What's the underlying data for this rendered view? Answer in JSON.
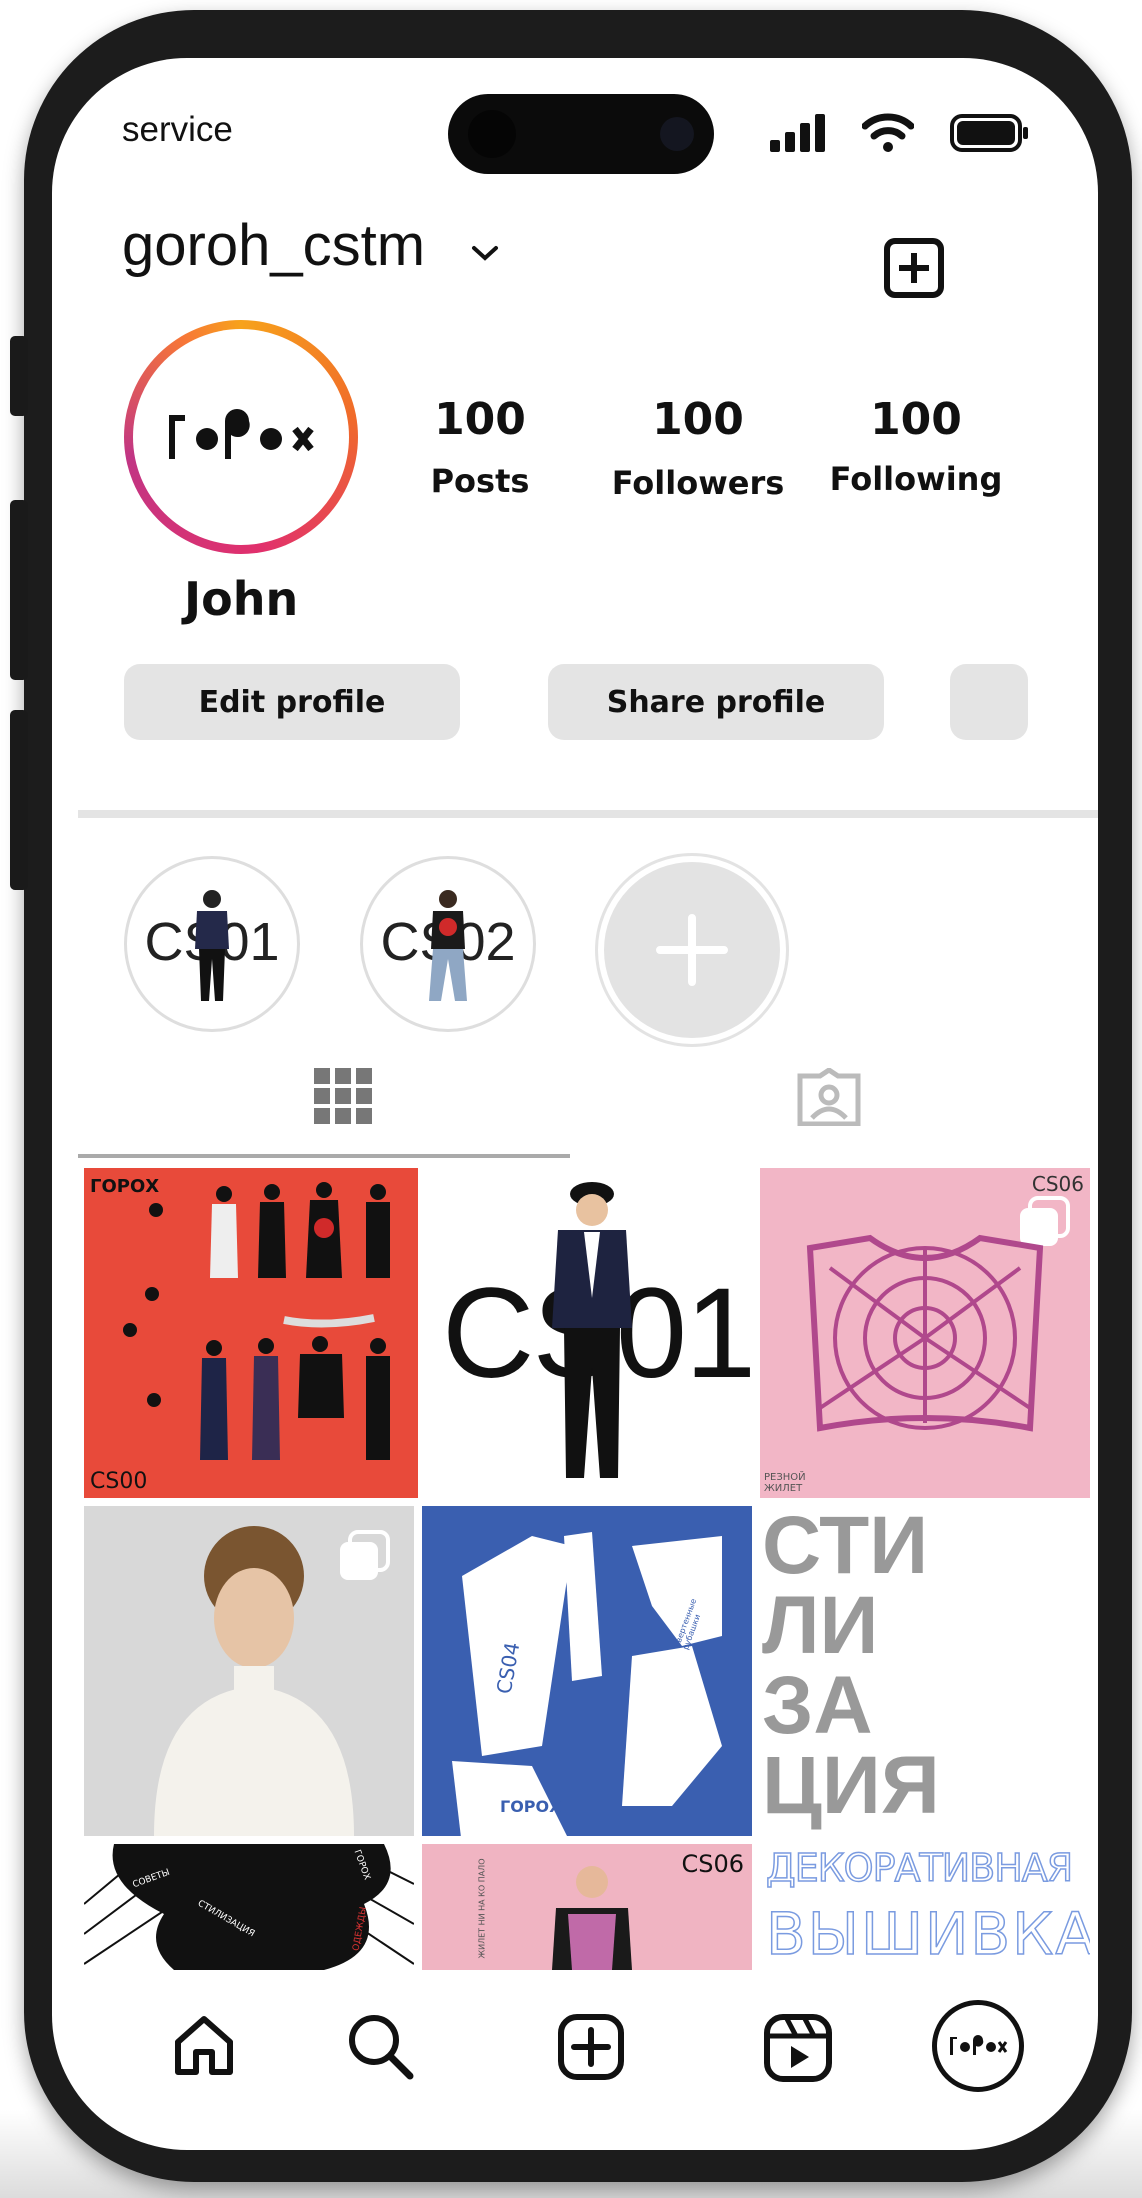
{
  "status_bar": {
    "carrier": "service"
  },
  "header": {
    "username": "goroh_cstm"
  },
  "profile": {
    "avatar_alt": "ГОРОХ logo",
    "display_name": "John",
    "stats": [
      {
        "value": "100",
        "label": "Posts"
      },
      {
        "value": "100",
        "label": "Followers"
      },
      {
        "value": "100",
        "label": "Following"
      }
    ],
    "buttons": {
      "edit": "Edit profile",
      "share": "Share profile"
    }
  },
  "highlights": [
    {
      "label": "CS01"
    },
    {
      "label": "CS02"
    }
  ],
  "tabs": [
    {
      "name": "grid",
      "icon": "grid-icon",
      "active": true
    },
    {
      "name": "tagged",
      "icon": "tagged-icon",
      "active": false
    }
  ],
  "posts": [
    {
      "tag": "CS00",
      "brand": "ГОРОХ"
    },
    {
      "text": "CS01"
    },
    {
      "tag": "CS06",
      "caption": "РЕЗНОЙ\nЖИЛЕТ"
    },
    {
      "multi": true
    },
    {
      "tag": "CS04",
      "side_text": "свертенные рубашки",
      "brand": "ГОРОХ"
    },
    {
      "lines": [
        "СТИ",
        "ЛИ",
        "ЗА",
        "ЦИЯ"
      ]
    },
    {
      "words": [
        "СОВЕТЫ",
        "ГОРОХ",
        "СТИЛИЗАЦИЯ",
        "ОДЕЖДЫ"
      ]
    },
    {
      "tag": "CS06",
      "side_text": "ЖИЛЕТ НИ НА КО ПАЛО"
    },
    {
      "lines": [
        "ДЕКОРАТИВНАЯ",
        "ВЫШИВКА"
      ]
    }
  ],
  "bottom_nav": [
    "home-icon",
    "search-icon",
    "create-icon",
    "reels-icon",
    "profile-avatar"
  ],
  "colors": {
    "red_tile": "#e84a3a",
    "blue_tile": "#3a5fb0",
    "pink_tile": "#f2b6c6",
    "ring_orange": "#f7a21b",
    "ring_pink": "#c13584"
  }
}
